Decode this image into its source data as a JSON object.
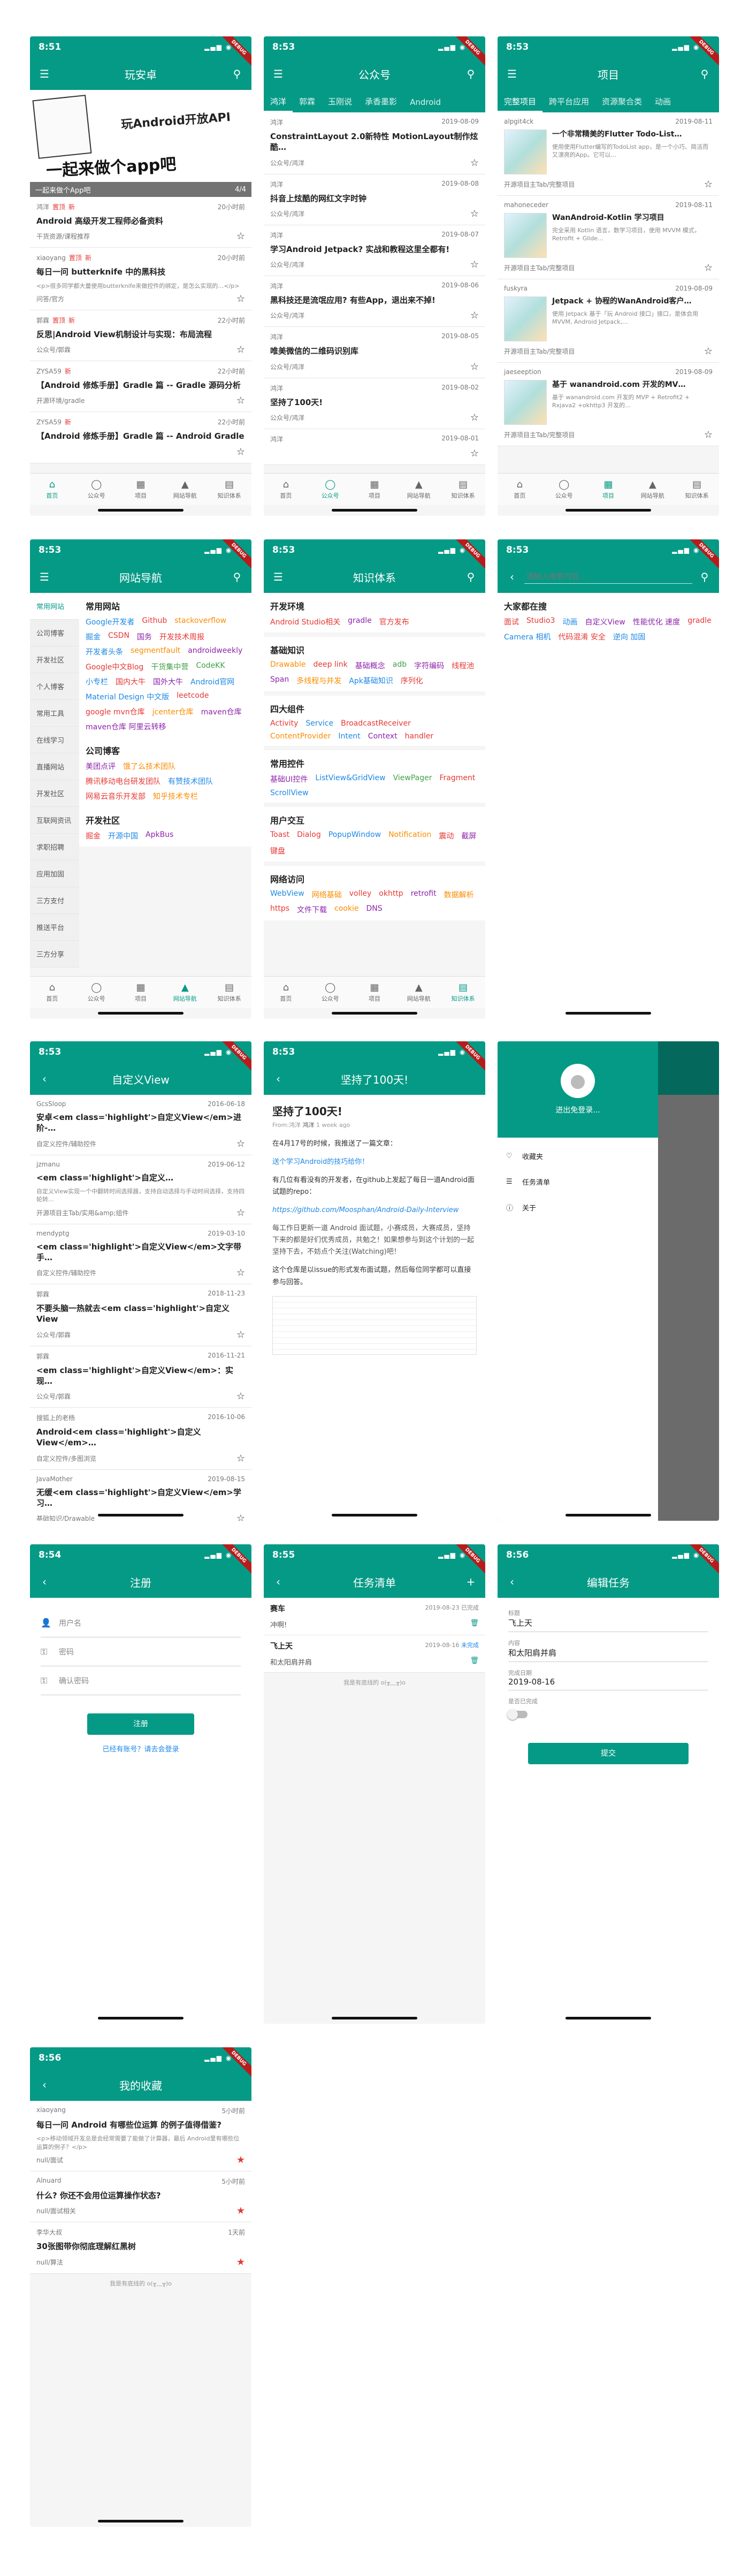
{
  "status": {
    "time1": "8:51",
    "time2": "8:53",
    "time4": "8:54",
    "time5": "8:55",
    "time6": "8:56"
  },
  "debug": "DEBUG",
  "home": {
    "title": "玩安卓",
    "banner_caption": "一起来做个App吧",
    "banner_index": "4/4",
    "banner_text": "一起来做个app吧",
    "banner_sub": "玩Android开放API",
    "items": [
      {
        "author": "鸿洋",
        "tags": [
          "置顶",
          "新"
        ],
        "date": "20小时前",
        "title": "Android 高级开发工程师必备资料",
        "cat": "干货资源/课程推荐"
      },
      {
        "author": "xiaoyang",
        "tags": [
          "置顶",
          "新"
        ],
        "date": "20小时前",
        "title": "每日一问 butterknife 中的黑科技",
        "desc": "<p>很多同学都大量使用butterknife来做控件的绑定，是怎么实现的…</p>",
        "cat": "问答/官方"
      },
      {
        "author": "郭霖",
        "tags": [
          "置顶",
          "新"
        ],
        "date": "22小时前",
        "title": "反思|Android View机制设计与实现：布局流程",
        "cat": "公众号/郭霖"
      },
      {
        "author": "ZYSA59",
        "tags": [
          "新"
        ],
        "date": "22小时前",
        "title": "【Android 修炼手册】Gradle 篇 -- Gradle 源码分析",
        "cat": "开源环境/gradle"
      },
      {
        "author": "ZYSA59",
        "tags": [
          "新"
        ],
        "date": "22小时前",
        "title": "【Android 修炼手册】Gradle 篇 -- Android Gradle",
        "cat": ""
      }
    ]
  },
  "nav": {
    "tabs": [
      "首页",
      "公众号",
      "项目",
      "网站导航",
      "知识体系"
    ]
  },
  "gzh": {
    "title": "公众号",
    "tabs": [
      "鸿洋",
      "郭霖",
      "玉刚说",
      "承香墨影",
      "Android"
    ],
    "items": [
      {
        "author": "鸿洋",
        "date": "2019-08-09",
        "title": "ConstraintLayout 2.0新特性 MotionLayout制作炫酷…",
        "cat": "公众号/鸿洋"
      },
      {
        "author": "鸿洋",
        "date": "2019-08-08",
        "title": "抖音上炫酷的网红文字时钟",
        "cat": "公众号/鸿洋"
      },
      {
        "author": "鸿洋",
        "date": "2019-08-07",
        "title": "学习Android Jetpack? 实战和教程这里全都有!",
        "cat": "公众号/鸿洋"
      },
      {
        "author": "鸿洋",
        "date": "2019-08-06",
        "title": "黑科技还是流氓应用? 有些App，退出来不掉!",
        "cat": "公众号/鸿洋"
      },
      {
        "author": "鸿洋",
        "date": "2019-08-05",
        "title": "唯美微信的二维码识别库",
        "cat": "公众号/鸿洋"
      },
      {
        "author": "鸿洋",
        "date": "2019-08-02",
        "title": "坚持了100天!",
        "cat": "公众号/鸿洋"
      },
      {
        "author": "鸿洋",
        "date": "2019-08-01",
        "title": "",
        "cat": ""
      }
    ]
  },
  "proj": {
    "title": "项目",
    "tabs": [
      "完整项目",
      "跨平台应用",
      "资源聚合类",
      "动画"
    ],
    "items": [
      {
        "author": "alpgit4ck",
        "date": "2019-08-11",
        "title": "一个非常精美的Flutter Todo-List…",
        "desc": "使用使用Flutter编写的TodoList app，是一个小巧、简洁而又漂亮的App。它可以…",
        "cat": "开源项目主Tab/完整项目"
      },
      {
        "author": "mahoneceder",
        "date": "2019-08-11",
        "title": "WanAndroid-Kotlin 学习项目",
        "desc": "完全采用 Kotlin 语言，数学习项目，使用 MVVM 模式，Retrofit + Glide…",
        "cat": "开源项目主Tab/完整项目"
      },
      {
        "author": "fuskyra",
        "date": "2019-08-09",
        "title": "Jetpack + 协程的WanAndroid客户…",
        "desc": "使用 Jetpack 基于「玩 Android 接口」接口，是体会用 MVVM, Android Jetpack,…",
        "cat": "开源项目主Tab/完整项目"
      },
      {
        "author": "jaeseeption",
        "date": "2019-08-09",
        "title": "基于 wanandroid.com 开发的MV…",
        "desc": "基于 wanandroid.com 开发的 MVP + Retrofit2 + Rxjava2 +okhttp3 开发的…",
        "cat": "开源项目主Tab/完整项目"
      }
    ]
  },
  "sites": {
    "title": "网站导航",
    "side": [
      "常用网站",
      "公司博客",
      "开发社区",
      "个人博客",
      "常用工具",
      "在线学习",
      "直播网站",
      "开发社区",
      "互联网资讯",
      "求职招聘",
      "应用加固",
      "三方支付",
      "推送平台",
      "三方分享"
    ],
    "sections": [
      {
        "name": "常用网站",
        "links": [
          [
            "Google开发者",
            "#1e88e5"
          ],
          [
            "Github",
            "#e53935"
          ],
          [
            "stackoverflow",
            "#fb8c00"
          ],
          [
            "掘金",
            "#1e88e5"
          ],
          [
            "CSDN",
            "#e53935"
          ],
          [
            "国务",
            "#8e24aa"
          ],
          [
            "开发技术周报",
            "#e53935"
          ],
          [
            "开发者头条",
            "#1e88e5"
          ],
          [
            "segmentfault",
            "#fb8c00"
          ],
          [
            "androidweekly",
            "#8e24aa"
          ],
          [
            "Google中文Blog",
            "#e53935"
          ],
          [
            "干货集中营",
            "#43a047"
          ],
          [
            "CodeKK",
            "#43a047"
          ],
          [
            "小专栏",
            "#1e88e5"
          ],
          [
            "国内大牛",
            "#e53935"
          ],
          [
            "国外大牛",
            "#8e24aa"
          ],
          [
            "Android官网",
            "#1e88e5"
          ],
          [
            "Material Design 中文版",
            "#1e88e5"
          ],
          [
            "leetcode",
            "#e53935"
          ],
          [
            "google mvn仓库",
            "#e53935"
          ],
          [
            "jcenter仓库",
            "#fb8c00"
          ],
          [
            "maven仓库",
            "#8e24aa"
          ],
          [
            "maven仓库 阿里云转移",
            "#8e24aa"
          ]
        ]
      },
      {
        "name": "公司博客",
        "links": [
          [
            "美团点评",
            "#8e24aa"
          ],
          [
            "饿了么技术团队",
            "#fb8c00"
          ],
          [
            "腾讯移动电台研发团队",
            "#e53935"
          ],
          [
            "有赞技术团队",
            "#1e88e5"
          ],
          [
            "网易云音乐开发部",
            "#e53935"
          ],
          [
            "知乎技术专栏",
            "#fb8c00"
          ]
        ]
      },
      {
        "name": "开发社区",
        "links": [
          [
            "掘金",
            "#e53935"
          ],
          [
            "开源中国",
            "#1e88e5"
          ],
          [
            "ApkBus",
            "#8e24aa"
          ]
        ]
      }
    ]
  },
  "tree": {
    "title": "知识体系",
    "sections": [
      {
        "name": "开发环境",
        "links": [
          [
            "Android Studio相关",
            "#e53935"
          ],
          [
            "gradle",
            "#8e24aa"
          ],
          [
            "官方发布",
            "#e53935"
          ]
        ]
      },
      {
        "name": "基础知识",
        "links": [
          [
            "Drawable",
            "#fb8c00"
          ],
          [
            "deep link",
            "#e53935"
          ],
          [
            "基础概念",
            "#8e24aa"
          ],
          [
            "adb",
            "#43a047"
          ],
          [
            "字符编码",
            "#8e24aa"
          ],
          [
            "线程池",
            "#e53935"
          ],
          [
            "Span",
            "#8e24aa"
          ],
          [
            "多线程与并发",
            "#fb8c00"
          ],
          [
            "Apk基础知识",
            "#1e88e5"
          ],
          [
            "序列化",
            "#e53935"
          ]
        ]
      },
      {
        "name": "四大组件",
        "links": [
          [
            "Activity",
            "#e53935"
          ],
          [
            "Service",
            "#1e88e5"
          ],
          [
            "BroadcastReceiver",
            "#e53935"
          ],
          [
            "ContentProvider",
            "#fb8c00"
          ],
          [
            "Intent",
            "#1e88e5"
          ],
          [
            "Context",
            "#8e24aa"
          ],
          [
            "handler",
            "#e53935"
          ]
        ]
      },
      {
        "name": "常用控件",
        "links": [
          [
            "基础UI控件",
            "#8e24aa"
          ],
          [
            "ListView&GridView",
            "#1e88e5"
          ],
          [
            "ViewPager",
            "#43a047"
          ],
          [
            "Fragment",
            "#e53935"
          ],
          [
            "ScrollView",
            "#1e88e5"
          ]
        ]
      },
      {
        "name": "用户交互",
        "links": [
          [
            "Toast",
            "#e53935"
          ],
          [
            "Dialog",
            "#e53935"
          ],
          [
            "PopupWindow",
            "#1e88e5"
          ],
          [
            "Notification",
            "#fb8c00"
          ],
          [
            "震动",
            "#e53935"
          ],
          [
            "截屏",
            "#8e24aa"
          ],
          [
            "键盘",
            "#e53935"
          ]
        ]
      },
      {
        "name": "网络访问",
        "links": [
          [
            "WebView",
            "#1e88e5"
          ],
          [
            "网络基础",
            "#fb8c00"
          ],
          [
            "volley",
            "#e53935"
          ],
          [
            "okhttp",
            "#e53935"
          ],
          [
            "retrofit",
            "#8e24aa"
          ],
          [
            "数据解析",
            "#fb8c00"
          ],
          [
            "https",
            "#e53935"
          ],
          [
            "文件下载",
            "#8e24aa"
          ],
          [
            "cookie",
            "#fb8c00"
          ],
          [
            "DNS",
            "#8e24aa"
          ]
        ]
      }
    ]
  },
  "search": {
    "placeholder": "请输入搜索内容...",
    "hot_title": "大家都在搜",
    "hot": [
      [
        "面试",
        "#e53935"
      ],
      [
        "Studio3",
        "#e53935"
      ],
      [
        "动画",
        "#1e88e5"
      ],
      [
        "自定义View",
        "#8e24aa"
      ],
      [
        "性能优化 速度",
        "#8e24aa"
      ],
      [
        "gradle",
        "#e53935"
      ],
      [
        "Camera 相机",
        "#1e88e5"
      ],
      [
        "代码混淆 安全",
        "#e53935"
      ],
      [
        "逆向 加固",
        "#1e88e5"
      ]
    ]
  },
  "cv": {
    "title": "自定义View",
    "items": [
      {
        "author": "GcsSloop",
        "date": "2016-06-18",
        "title": "安卓<em class='highlight'>自定义View</em>进阶-…",
        "cat": "自定义控件/辅助控件"
      },
      {
        "author": "jzmanu",
        "date": "2019-06-12",
        "title": "<em class='highlight'>自定义…",
        "desc": "自定义View实现一个中翻转时间选择器，支持自动选择与手动时间选择，支持四轮转…",
        "cat": "开源项目主Tab/实用&amp;组件"
      },
      {
        "author": "mendyptg",
        "date": "2019-03-10",
        "title": "<em class='highlight'>自定义View</em>文字带手…",
        "cat": "自定义控件/辅助控件"
      },
      {
        "author": "郭霖",
        "date": "2018-11-23",
        "title": "不要头脑一热就去<em class='highlight'>自定义View",
        "cat": "公众号/郭霖"
      },
      {
        "author": "郭霖",
        "date": "2016-11-21",
        "title": "<em class='highlight'>自定义View</em>：实现…",
        "cat": "公众号/郭霖"
      },
      {
        "author": "搜狐上的老杨",
        "date": "2016-10-06",
        "title": "Android<em class='highlight'>自定义View</em>…",
        "cat": "自定义控件/多图浏览"
      },
      {
        "author": "JavaMother",
        "date": "2019-08-15",
        "title": "无缓<em class='highlight'>自定义View</em>学习…",
        "cat": "基础知识/Drawable"
      }
    ]
  },
  "article": {
    "title": "坚持了100天!",
    "heading": "坚持了100天!",
    "meta_from": "From:鸿洋",
    "meta_author": "鸿洋",
    "meta_time": "1 week ago",
    "p1": "在4月17号的时候，我推送了一篇文章：",
    "p2": "送个学习Android的技巧给你！",
    "p3": "有几位有看没有的开发者，在github上发起了每日一道Android面试题的repo：",
    "link": "https://github.com/Moosphan/Android-Daily-Interview",
    "p4": "每工作日更新一道 Android 面试题，小赛成员，大赛成员，坚持下来的都是好们优秀成员，共勉之！如果想参与到这个计划的一起坚持下去，不妨点个关注(Watching)吧！",
    "p5": "这个仓库是以issue的形式发布面试题，然后每位同学都可以直接参与回答。"
  },
  "drawer": {
    "login": "进出免登录...",
    "items": [
      "收藏夹",
      "任务清单",
      "关于"
    ]
  },
  "login": {
    "title": "注册",
    "user": "用户名",
    "pwd": "密码",
    "pwd2": "确认密码",
    "btn": "注册",
    "link": "已经有账号？请去会登录"
  },
  "todo": {
    "title": "任务清单",
    "items": [
      {
        "title": "赛车",
        "date": "2019-08-23",
        "status": "已完成",
        "sub": "冲啊!"
      },
      {
        "title": "飞上天",
        "date": "2019-08-16",
        "status": "未完成",
        "sub": "和太阳肩并肩"
      }
    ],
    "end": "我是有底线的 o(╥﹏╥)o"
  },
  "edit": {
    "title": "编辑任务",
    "l1": "标题",
    "v1": "飞上天",
    "l2": "内容",
    "v2": "和太阳肩并肩",
    "l3": "完成日期",
    "v3": "2019-08-16",
    "l4": "是否已完成",
    "btn": "提交"
  },
  "fav": {
    "title": "我的收藏",
    "items": [
      {
        "author": "xiaoyang",
        "date": "5小时前",
        "title": "每日一问 Android 有哪些位运算 的例子值得借鉴?",
        "desc": "<p>移动领域开发总是会经常需要了能做了计算器，最后 Android里有哪些位运算的例子？</p>",
        "cat": "null/面试"
      },
      {
        "author": "Alnuard",
        "date": "5小时前",
        "title": "什么? 你还不会用位运算操作状态?",
        "cat": "null/面试相关"
      },
      {
        "author": "李华大叔",
        "date": "1天前",
        "title": "30张图带你彻底理解红黑树",
        "cat": "null/算法"
      }
    ],
    "end": "我是有底线的 o(╥﹏╥)o"
  },
  "colors": {
    "primary": "#059a86",
    "accent": "#e53935"
  }
}
